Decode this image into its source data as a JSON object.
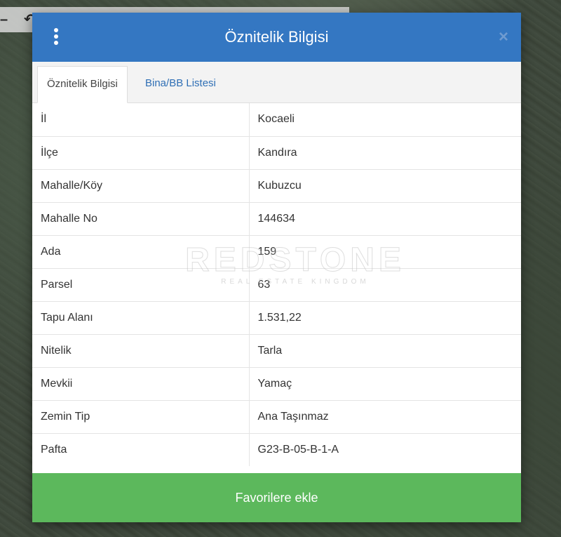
{
  "dialog": {
    "title": "Öznitelik Bilgisi",
    "close_symbol": "×",
    "menu_icon": "vertical-ellipsis-icon"
  },
  "tabs": [
    {
      "label": "Öznitelik Bilgisi",
      "active": true
    },
    {
      "label": "Bina/BB Listesi",
      "active": false
    }
  ],
  "attributes": [
    {
      "key": "İl",
      "value": "Kocaeli"
    },
    {
      "key": "İlçe",
      "value": "Kandıra"
    },
    {
      "key": "Mahalle/Köy",
      "value": "Kubuzcu"
    },
    {
      "key": "Mahalle No",
      "value": "144634"
    },
    {
      "key": "Ada",
      "value": "159"
    },
    {
      "key": "Parsel",
      "value": "63"
    },
    {
      "key": "Tapu Alanı",
      "value": "1.531,22"
    },
    {
      "key": "Nitelik",
      "value": "Tarla"
    },
    {
      "key": "Mevkii",
      "value": "Yamaç"
    },
    {
      "key": "Zemin Tip",
      "value": "Ana Taşınmaz"
    },
    {
      "key": "Pafta",
      "value": "G23-B-05-B-1-A"
    }
  ],
  "watermark": {
    "name": "REDSTONE",
    "tagline": "REAL ESTATE KINGDOM"
  },
  "footer": {
    "favorite_label": "Favorilere ekle"
  },
  "colors": {
    "header": "#3477c2",
    "tab_link": "#2f6fb5",
    "favorite_button": "#5cb85c"
  }
}
